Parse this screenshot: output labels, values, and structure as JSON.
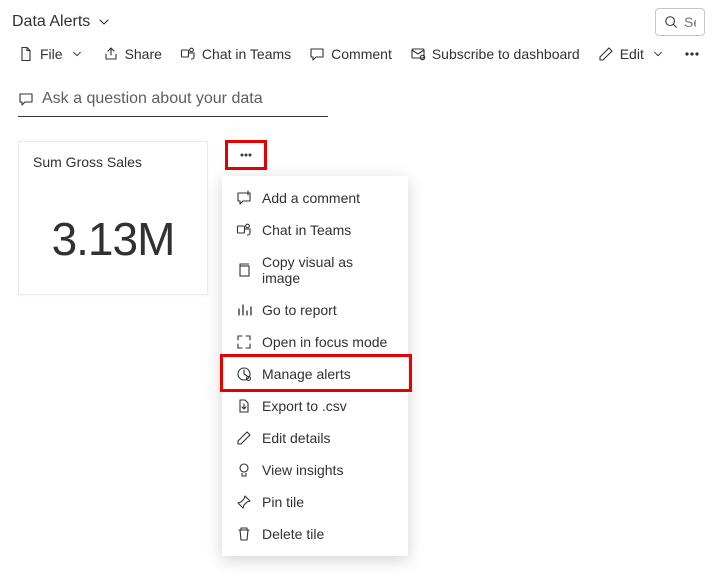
{
  "breadcrumb": {
    "title": "Data Alerts"
  },
  "search": {
    "placeholder": "Sea"
  },
  "toolbar": {
    "file": "File",
    "share": "Share",
    "chat": "Chat in Teams",
    "comment": "Comment",
    "subscribe": "Subscribe to dashboard",
    "edit": "Edit"
  },
  "ask": {
    "placeholder": "Ask a question about your data"
  },
  "tile": {
    "title": "Sum Gross Sales",
    "value": "3.13M"
  },
  "menu": {
    "add_comment": "Add a comment",
    "chat": "Chat in Teams",
    "copy_visual": "Copy visual as image",
    "go_report": "Go to report",
    "focus": "Open in focus mode",
    "manage_alerts": "Manage alerts",
    "export_csv": "Export to .csv",
    "edit_details": "Edit details",
    "view_insights": "View insights",
    "pin_tile": "Pin tile",
    "delete_tile": "Delete tile"
  }
}
